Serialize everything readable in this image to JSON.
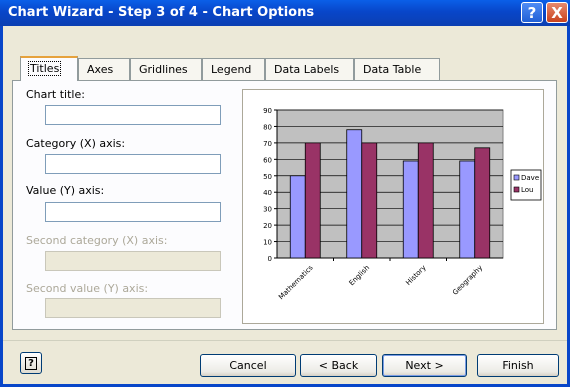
{
  "window": {
    "title": "Chart Wizard - Step 3 of 4 - Chart Options",
    "help_glyph": "?",
    "close_glyph": "X"
  },
  "tabs": [
    {
      "label": "Titles",
      "active": true
    },
    {
      "label": "Axes",
      "active": false
    },
    {
      "label": "Gridlines",
      "active": false
    },
    {
      "label": "Legend",
      "active": false
    },
    {
      "label": "Data Labels",
      "active": false
    },
    {
      "label": "Data Table",
      "active": false
    }
  ],
  "fields": {
    "chart_title": {
      "label": "Chart title:",
      "value": "",
      "enabled": true
    },
    "category_x_axis": {
      "label": "Category (X) axis:",
      "value": "",
      "enabled": true
    },
    "value_y_axis": {
      "label": "Value (Y) axis:",
      "value": "",
      "enabled": true
    },
    "second_category_x_axis": {
      "label": "Second category (X) axis:",
      "value": "",
      "enabled": false
    },
    "second_value_y_axis": {
      "label": "Second value (Y) axis:",
      "value": "",
      "enabled": false
    }
  },
  "buttons": {
    "cancel": "Cancel",
    "back": "< Back",
    "next": "Next >",
    "finish": "Finish",
    "help_glyph": "?"
  },
  "chart_data": {
    "type": "bar",
    "categories": [
      "Mathematics",
      "English",
      "History",
      "Geography"
    ],
    "series": [
      {
        "name": "Dave",
        "values": [
          50,
          78,
          59,
          59
        ],
        "color": "#9999ff"
      },
      {
        "name": "Lou",
        "values": [
          70,
          70,
          70,
          67
        ],
        "color": "#993366"
      }
    ],
    "yticks": [
      0,
      10,
      20,
      30,
      40,
      50,
      60,
      70,
      80,
      90
    ],
    "ylim": [
      0,
      90
    ],
    "grid": true,
    "plot_background": "#c0c0c0",
    "legend": "right"
  }
}
